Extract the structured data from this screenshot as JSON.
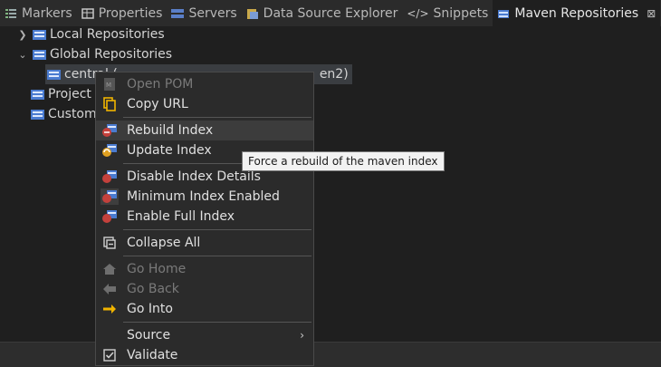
{
  "tabs": [
    {
      "label": "Markers",
      "icon": "markers-icon"
    },
    {
      "label": "Properties",
      "icon": "properties-icon"
    },
    {
      "label": "Servers",
      "icon": "servers-icon"
    },
    {
      "label": "Data Source Explorer",
      "icon": "data-source-icon"
    },
    {
      "label": "Snippets",
      "icon": "snippets-icon"
    },
    {
      "label": "Maven Repositories",
      "icon": "maven-repo-icon",
      "active": true
    }
  ],
  "tab_close": "⊠",
  "tree": {
    "local": "Local Repositories",
    "global": "Global Repositories",
    "central": "central (",
    "central_tail": "en2)",
    "project": "Project",
    "custom": "Custom"
  },
  "menu": {
    "open_pom": "Open POM",
    "copy_url": "Copy URL",
    "rebuild_index": "Rebuild Index",
    "update_index": "Update Index",
    "disable_index_details": "Disable Index Details",
    "minimum_index_enabled": "Minimum Index Enabled",
    "enable_full_index": "Enable Full Index",
    "collapse_all": "Collapse All",
    "go_home": "Go Home",
    "go_back": "Go Back",
    "go_into": "Go Into",
    "source": "Source",
    "validate": "Validate"
  },
  "tooltip": "Force a rebuild of the maven index",
  "colors": {
    "accent_yellow": "#f0b400",
    "maven_red": "#c4413c",
    "repo_blue": "#4a7bd0"
  }
}
